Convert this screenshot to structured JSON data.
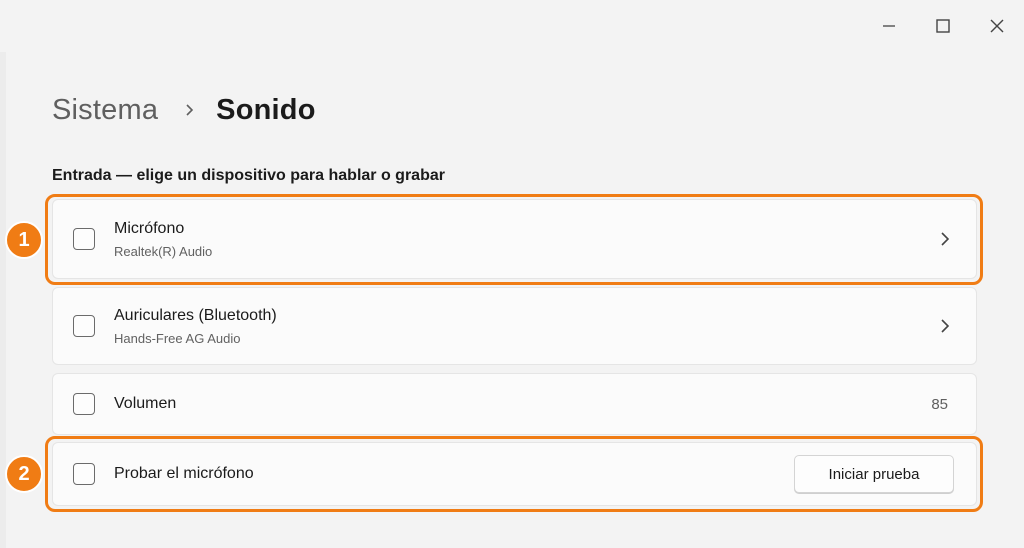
{
  "window": {
    "controls": {
      "minimize_icon": "minimize-icon",
      "maximize_icon": "maximize-icon",
      "close_icon": "close-icon"
    }
  },
  "breadcrumb": {
    "parent": "Sistema",
    "separator_icon": "chevron-right-icon",
    "current": "Sonido"
  },
  "section": {
    "heading": "Entrada — elige un dispositivo para hablar o grabar"
  },
  "items": [
    {
      "title": "Micrófono",
      "subtitle": "Realtek(R) Audio",
      "trailing_icon": "chevron-right-icon"
    },
    {
      "title": "Auriculares (Bluetooth)",
      "subtitle": "Hands-Free AG Audio",
      "trailing_icon": "chevron-right-icon"
    },
    {
      "title": "Volumen",
      "value": "85"
    },
    {
      "title": "Probar el micrófono",
      "button_label": "Iniciar prueba"
    }
  ],
  "annotations": [
    {
      "label": "1"
    },
    {
      "label": "2"
    }
  ],
  "colors": {
    "accent": "#f07c14",
    "background": "#f3f3f3",
    "card": "#fbfbfb"
  }
}
